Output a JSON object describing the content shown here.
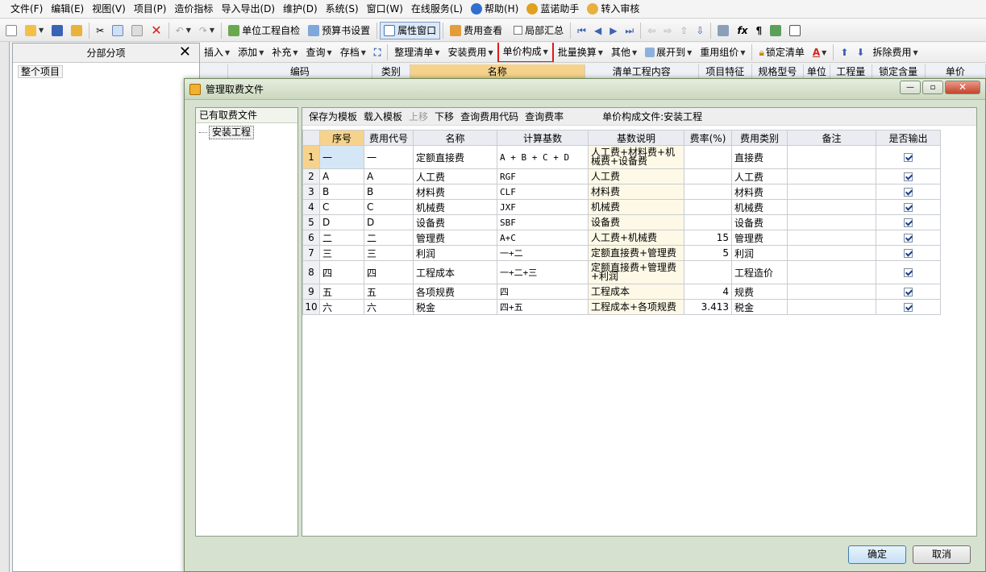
{
  "menubar": {
    "items": [
      {
        "label": "文件(F)",
        "icon": ""
      },
      {
        "label": "编辑(E)",
        "icon": ""
      },
      {
        "label": "视图(V)",
        "icon": ""
      },
      {
        "label": "项目(P)",
        "icon": ""
      },
      {
        "label": "造价指标",
        "icon": ""
      },
      {
        "label": "导入导出(D)",
        "icon": ""
      },
      {
        "label": "维护(D)",
        "icon": ""
      },
      {
        "label": "系统(S)",
        "icon": ""
      },
      {
        "label": "窗口(W)",
        "icon": ""
      },
      {
        "label": "在线服务(L)",
        "icon": ""
      },
      {
        "label": "帮助(H)",
        "icon": "help-icon"
      },
      {
        "label": "蓝诺助手",
        "icon": "assistant-icon"
      },
      {
        "label": "转入审核",
        "icon": "review-icon"
      }
    ]
  },
  "toolbar1": {
    "self_check": "单位工程自检",
    "budget_settings": "预算书设置",
    "property_window": "属性窗口",
    "fee_view": "费用查看",
    "partial_summary": "局部汇总"
  },
  "toolbar2": {
    "insert": "插入",
    "add": "添加",
    "supplement": "补充",
    "query": "查询",
    "archive": "存档",
    "organize": "整理清单",
    "install_fee": "安装费用",
    "unit_price": "单价构成",
    "batch_convert": "批量换算",
    "other": "其他",
    "expand_to": "展开到",
    "reuse_price": "重用组价",
    "lock_list": "锁定清单",
    "split_fee": "拆除费用"
  },
  "left_panel": {
    "title": "分部分项",
    "root": "整个项目"
  },
  "bg_table": {
    "headers": [
      "编码",
      "类别",
      "名称",
      "清单工程内容",
      "项目特征",
      "规格型号",
      "单位",
      "工程量",
      "锁定含量",
      "单价"
    ]
  },
  "dialog": {
    "title": "管理取费文件",
    "files_title": "已有取费文件",
    "file_item": "安装工程",
    "toolbar": {
      "save_template": "保存为模板",
      "load_template": "载入模板",
      "move_up": "上移",
      "move_down": "下移",
      "query_code": "查询费用代码",
      "query_rate": "查询费率"
    },
    "file_label_prefix": "单价构成文件:",
    "file_label_value": "安装工程",
    "columns": [
      "序号",
      "费用代号",
      "名称",
      "计算基数",
      "基数说明",
      "费率(%)",
      "费用类别",
      "备注",
      "是否输出"
    ],
    "rows": [
      {
        "no": "1",
        "seq": "一",
        "code": "一",
        "name": "定额直接费",
        "base": "A + B + C + D",
        "basis": "人工费+材料费+机械费+设备费",
        "rate": "",
        "category": "直接费",
        "note": "",
        "output": true
      },
      {
        "no": "2",
        "seq": "A",
        "code": "A",
        "name": "人工费",
        "base": "RGF",
        "basis": "人工费",
        "rate": "",
        "category": "人工费",
        "note": "",
        "output": true
      },
      {
        "no": "3",
        "seq": "B",
        "code": "B",
        "name": "材料费",
        "base": "CLF",
        "basis": "材料费",
        "rate": "",
        "category": "材料费",
        "note": "",
        "output": true
      },
      {
        "no": "4",
        "seq": "C",
        "code": "C",
        "name": "机械费",
        "base": "JXF",
        "basis": "机械费",
        "rate": "",
        "category": "机械费",
        "note": "",
        "output": true
      },
      {
        "no": "5",
        "seq": "D",
        "code": "D",
        "name": "设备费",
        "base": "SBF",
        "basis": "设备费",
        "rate": "",
        "category": "设备费",
        "note": "",
        "output": true
      },
      {
        "no": "6",
        "seq": "二",
        "code": "二",
        "name": "管理费",
        "base": "A+C",
        "basis": "人工费+机械费",
        "rate": "15",
        "category": "管理费",
        "note": "",
        "output": true
      },
      {
        "no": "7",
        "seq": "三",
        "code": "三",
        "name": "利润",
        "base": "一+二",
        "basis": "定额直接费+管理费",
        "rate": "5",
        "category": "利润",
        "note": "",
        "output": true
      },
      {
        "no": "8",
        "seq": "四",
        "code": "四",
        "name": "工程成本",
        "base": "一+二+三",
        "basis": "定额直接费+管理费+利润",
        "rate": "",
        "category": "工程造价",
        "note": "",
        "output": true
      },
      {
        "no": "9",
        "seq": "五",
        "code": "五",
        "name": "各项规费",
        "base": "四",
        "basis": "工程成本",
        "rate": "4",
        "category": "规费",
        "note": "",
        "output": true
      },
      {
        "no": "10",
        "seq": "六",
        "code": "六",
        "name": "税金",
        "base": "四+五",
        "basis": "工程成本+各项规费",
        "rate": "3.413",
        "category": "税金",
        "note": "",
        "output": true
      }
    ],
    "ok": "确定",
    "cancel": "取消"
  },
  "colors": {
    "highlight_border": "#e0191b",
    "selected_header": "#f6d38c",
    "dialog_bg": "#d7e1cf"
  }
}
